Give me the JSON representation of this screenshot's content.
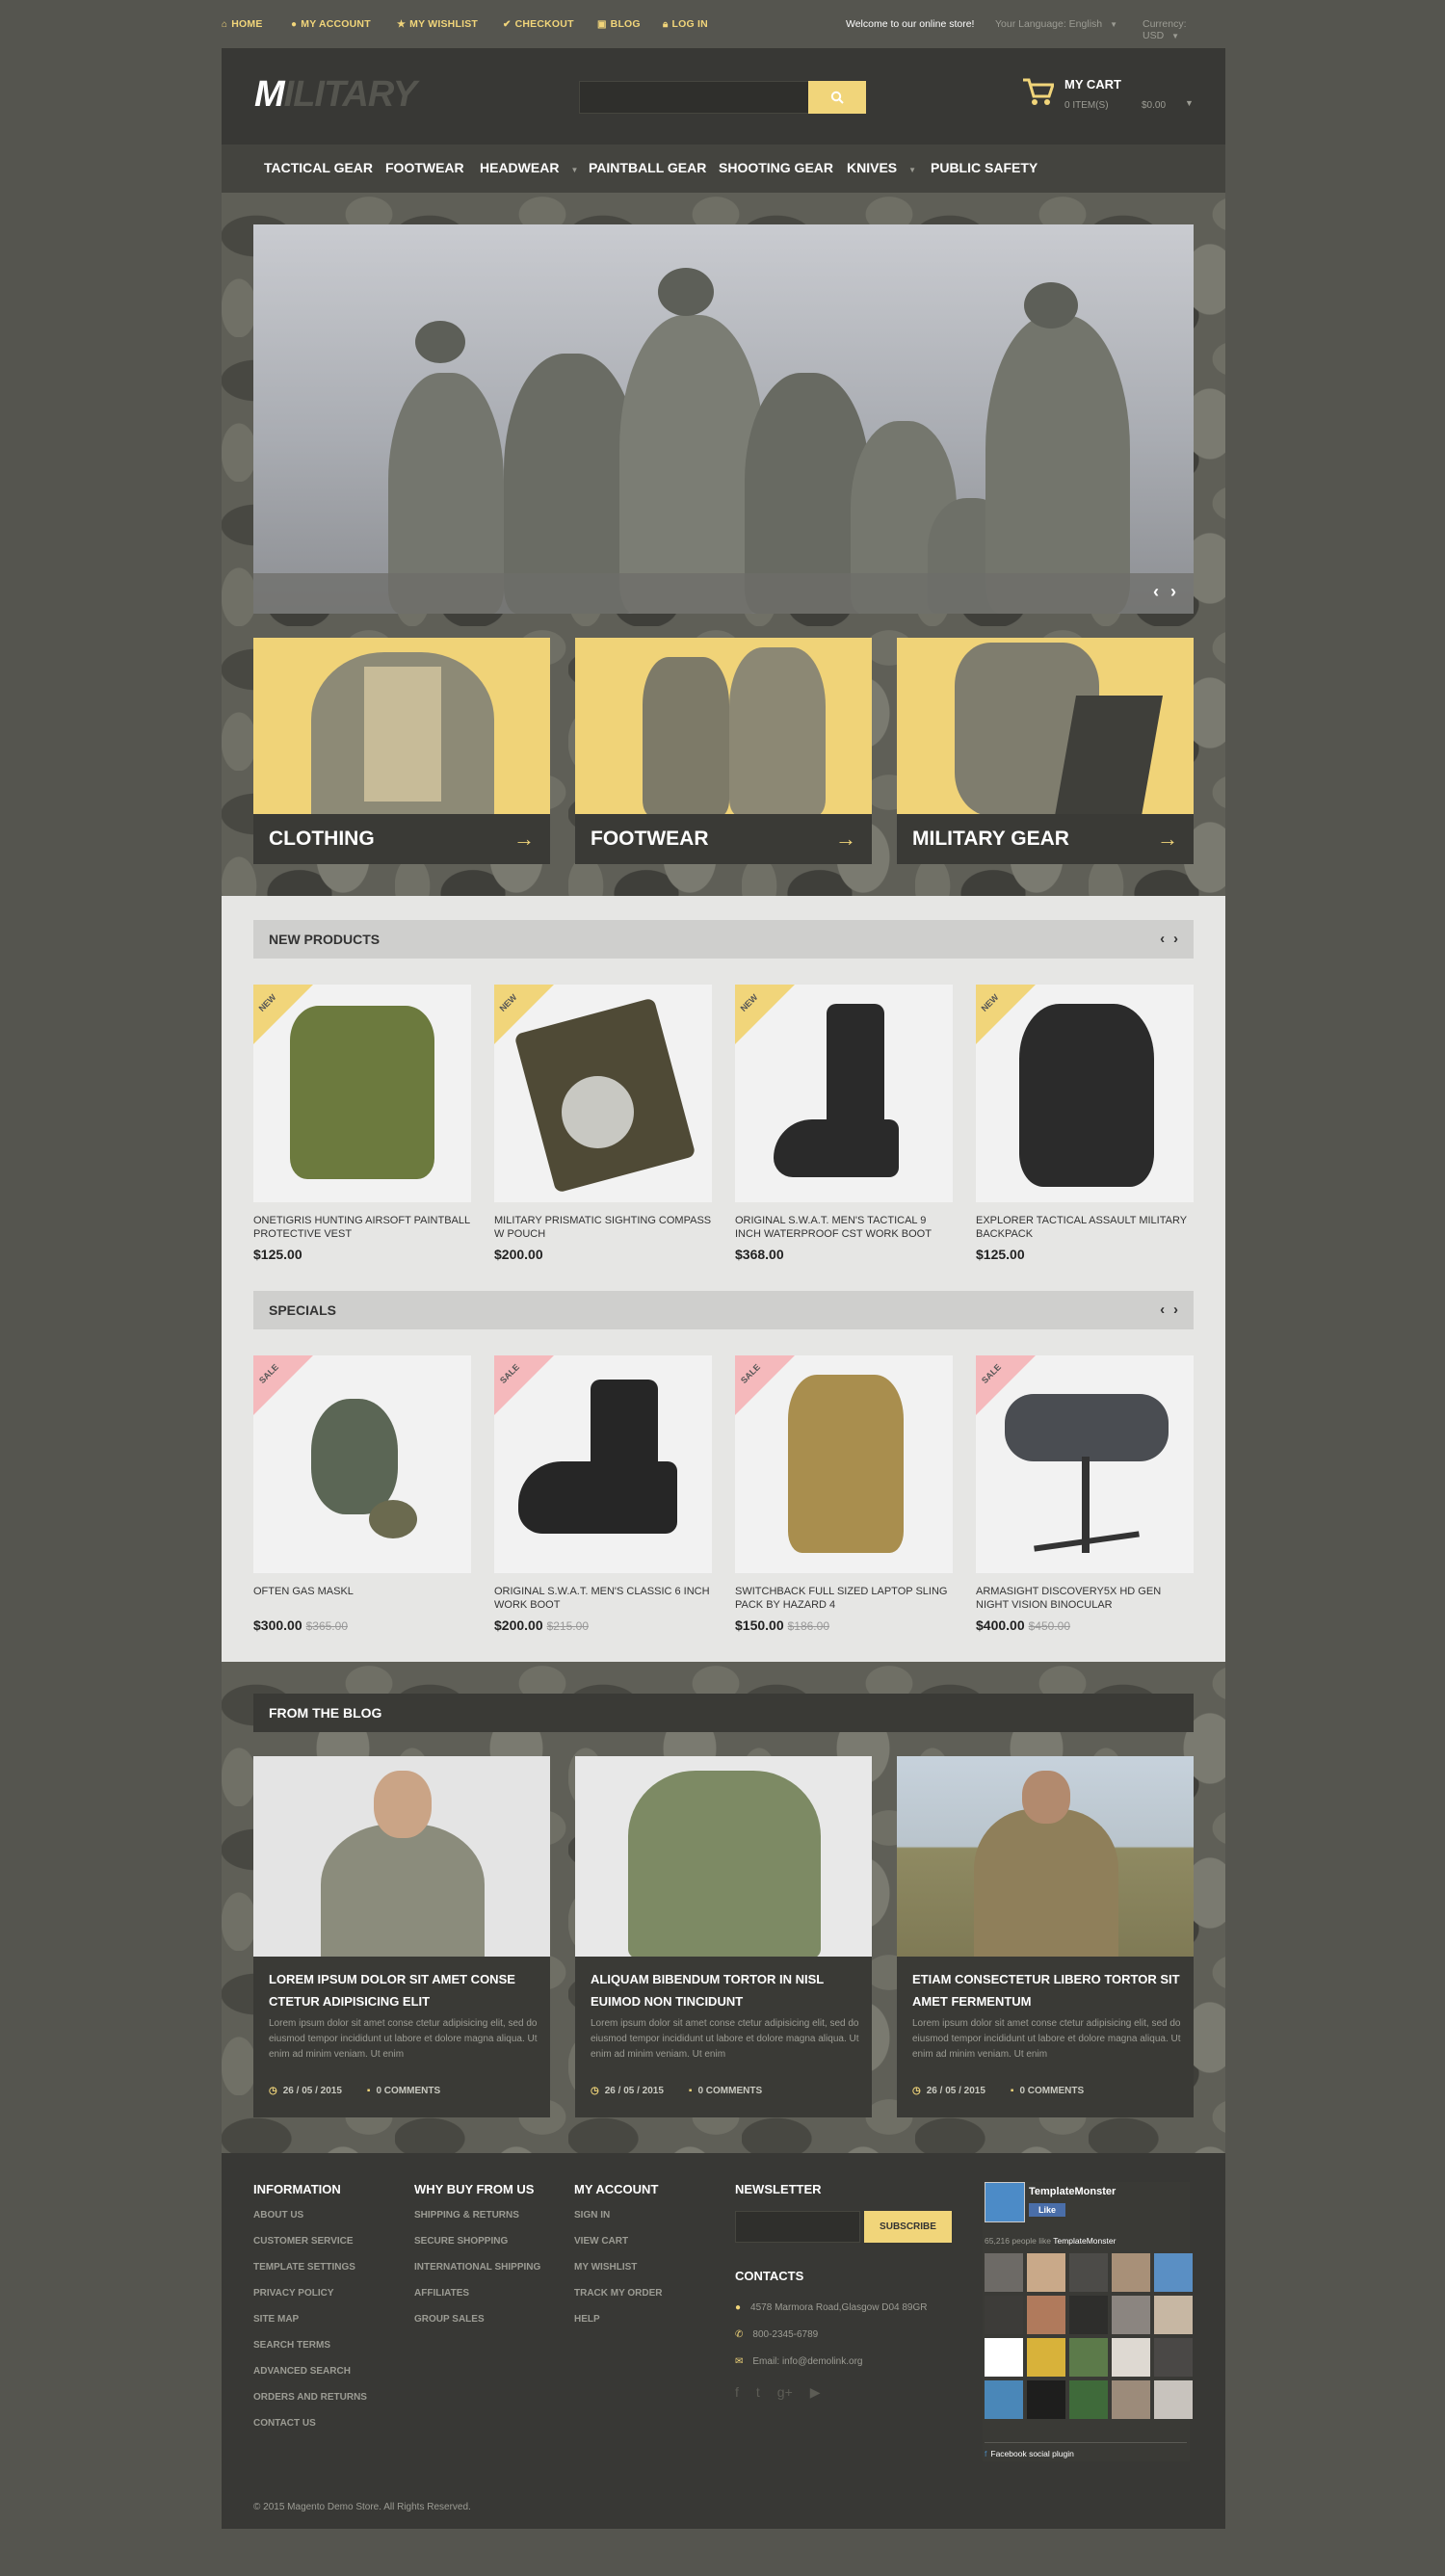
{
  "topbar": {
    "links": [
      "HOME",
      "MY ACCOUNT",
      "MY WISHLIST",
      "CHECKOUT",
      "BLOG",
      "LOG IN"
    ],
    "welcome": "Welcome to our online store!",
    "language": "Your Language: English",
    "currency": "Currency: USD"
  },
  "header": {
    "logo_first": "M",
    "logo_rest": "ILITARY",
    "search_placeholder": "",
    "cart_title": "MY CART",
    "cart_items": "0 ITEM(S)",
    "cart_total": "$0.00"
  },
  "nav": [
    "TACTICAL GEAR",
    "FOOTWEAR",
    "HEADWEAR",
    "PAINTBALL GEAR",
    "SHOOTING GEAR",
    "KNIVES",
    "PUBLIC SAFETY"
  ],
  "banners": [
    "CLOTHING",
    "FOOTWEAR",
    "MILITARY GEAR"
  ],
  "new_products": {
    "title": "NEW PRODUCTS",
    "ribbon": "NEW",
    "items": [
      {
        "name": "ONETIGRIS HUNTING AIRSOFT PAINTBALL PROTECTIVE VEST",
        "price": "$125.00"
      },
      {
        "name": "MILITARY PRISMATIC SIGHTING COMPASS W POUCH",
        "price": "$200.00"
      },
      {
        "name": "ORIGINAL S.W.A.T. MEN'S TACTICAL 9 INCH WATERPROOF CST WORK BOOT",
        "price": "$368.00"
      },
      {
        "name": "EXPLORER TACTICAL ASSAULT MILITARY BACKPACK",
        "price": "$125.00"
      }
    ]
  },
  "specials": {
    "title": "SPECIALS",
    "ribbon": "SALE",
    "items": [
      {
        "name": "OFTEN GAS MASKL",
        "price": "$300.00",
        "old": "$365.00"
      },
      {
        "name": "ORIGINAL S.W.A.T. MEN'S CLASSIC 6 INCH WORK BOOT",
        "price": "$200.00",
        "old": "$215.00"
      },
      {
        "name": "SWITCHBACK FULL SIZED LAPTOP SLING PACK BY HAZARD 4",
        "price": "$150.00",
        "old": "$186.00"
      },
      {
        "name": "ARMASIGHT DISCOVERY5X HD GEN NIGHT VISION BINOCULAR",
        "price": "$400.00",
        "old": "$450.00"
      }
    ]
  },
  "blog": {
    "title": "FROM THE BLOG",
    "posts": [
      {
        "title": "LOREM IPSUM DOLOR SIT AMET CONSE CTETUR ADIPISICING ELIT",
        "excerpt": "Lorem ipsum dolor sit amet conse ctetur adipisicing elit, sed do eiusmod tempor incididunt ut labore et dolore magna aliqua. Ut enim ad minim veniam. Ut enim",
        "date": "26 / 05 / 2015",
        "comments": "0 COMMENTS"
      },
      {
        "title": "ALIQUAM BIBENDUM TORTOR IN NISL EUIMOD NON TINCIDUNT",
        "excerpt": "Lorem ipsum dolor sit amet conse ctetur adipisicing elit, sed do eiusmod tempor incididunt ut labore et dolore magna aliqua. Ut enim ad minim veniam. Ut enim",
        "date": "26 / 05 / 2015",
        "comments": "0 COMMENTS"
      },
      {
        "title": "ETIAM CONSECTETUR LIBERO TORTOR SIT AMET FERMENTUM",
        "excerpt": "Lorem ipsum dolor sit amet conse ctetur adipisicing elit, sed do eiusmod tempor incididunt ut labore et dolore magna aliqua. Ut enim ad minim veniam. Ut enim",
        "date": "26 / 05 / 2015",
        "comments": "0 COMMENTS"
      }
    ]
  },
  "footer": {
    "information": {
      "title": "INFORMATION",
      "links": [
        "ABOUT US",
        "CUSTOMER SERVICE",
        "TEMPLATE SETTINGS",
        "PRIVACY POLICY",
        "SITE MAP",
        "SEARCH TERMS",
        "ADVANCED SEARCH",
        "ORDERS AND RETURNS",
        "CONTACT US"
      ]
    },
    "why": {
      "title": "WHY BUY FROM US",
      "links": [
        "SHIPPING & RETURNS",
        "SECURE SHOPPING",
        "INTERNATIONAL SHIPPING",
        "AFFILIATES",
        "GROUP SALES"
      ]
    },
    "account": {
      "title": "MY ACCOUNT",
      "links": [
        "SIGN IN",
        "VIEW CART",
        "MY WISHLIST",
        "TRACK MY ORDER",
        "HELP"
      ]
    },
    "newsletter": {
      "title": "NEWSLETTER",
      "button": "SUBSCRIBE"
    },
    "contacts": {
      "title": "CONTACTS",
      "address": "4578 Marmora Road,Glasgow D04 89GR",
      "phone": "800-2345-6789",
      "email": "Email: info@demolink.org"
    },
    "facebook": {
      "name": "TemplateMonster",
      "like": "Like",
      "count": "65,216 people like",
      "count_name": "TemplateMonster",
      "plugin": "Facebook social plugin"
    },
    "copyright": "© 2015 Magento Demo Store. All Rights Reserved."
  },
  "colors": {
    "accent": "#f1d57a",
    "dark": "#383835",
    "page_bg": "#55554f"
  }
}
